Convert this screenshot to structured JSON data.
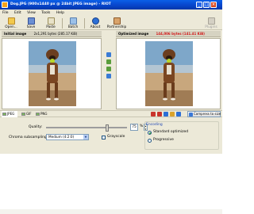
{
  "window": {
    "title": "Dog.JPG (900x1440 px @ 24bit JPEG image) - RIOT"
  },
  "menu": [
    "File",
    "Edit",
    "View",
    "Tools",
    "Help"
  ],
  "toolbar": {
    "buttons": [
      "Open...",
      "Save",
      "Paste",
      "Batch",
      "About",
      "Partnership"
    ],
    "disabled_button": "Plugins"
  },
  "panels": {
    "initial_title": "Initial image",
    "initial_size": "2x1,291 bytes (285.17 KiB)",
    "optimized_title": "Optimized image",
    "optimized_size": "144,006 bytes (141.41 KiB)"
  },
  "tabs": {
    "formats": [
      "JPEG",
      "GIF",
      "PNG"
    ],
    "compress_button": "Compress to size"
  },
  "options": {
    "quality_label": "Quality:",
    "quality_value": "75",
    "quality_unit": "%",
    "quality_fraction": 0.75,
    "chroma_label": "Chroma subsampling:",
    "chroma_value": "Medium (4:2:0)",
    "grayscale_label": "Grayscale",
    "encoding_title": "Encoding",
    "encoding_standard": "Standard optimized",
    "encoding_progressive": "Progressive"
  },
  "colors": {
    "titlebar": "#0a5fe8",
    "optimized_size": "#d21a1a",
    "encoding_title": "#1d45b4"
  }
}
